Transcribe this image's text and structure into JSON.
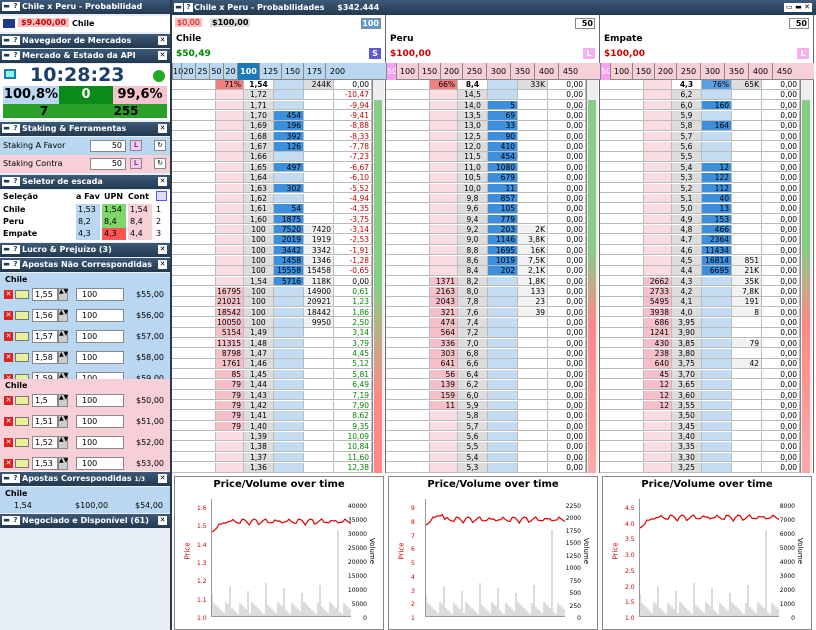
{
  "left": {
    "title": "Chile x Peru - Probabilidad",
    "balance": "$9.400,00",
    "balance_sel": "Chile",
    "nav_title": "Navegador de Mercados",
    "api_title": "Mercado & Estado da API",
    "clock": "10:28:23",
    "back_pct": "100,8%",
    "mid": "0",
    "lay_pct": "99,6%",
    "count1": "7",
    "count2": "255",
    "staking_title": "Staking & Ferramentas",
    "stake_back_label": "Staking A Favor",
    "stake_back_val": "50",
    "stake_lay_label": "Staking Contra",
    "stake_lay_val": "50",
    "ladder_sel_title": "Seletor de escada",
    "sel_headers": [
      "Seleção",
      "a Fav",
      "UPN",
      "Cont"
    ],
    "sel_rows": [
      [
        "Chile",
        "1,53",
        "1,54",
        "1,54",
        "1"
      ],
      [
        "Peru",
        "8,2",
        "8,4",
        "8,4",
        "2"
      ],
      [
        "Empate",
        "4,3",
        "4,3",
        "4,4",
        "3"
      ]
    ],
    "pnl_title": "Lucro & Prejuízo (3)",
    "unmatched_title": "Apostas Não Correspondidas",
    "unmatched_group1": "Chile",
    "unmatched1": [
      [
        "1,55",
        "100",
        "$55,00"
      ],
      [
        "1,56",
        "100",
        "$56,00"
      ],
      [
        "1,57",
        "100",
        "$57,00"
      ],
      [
        "1,58",
        "100",
        "$58,00"
      ],
      [
        "1,59",
        "100",
        "$59,00"
      ]
    ],
    "unmatched_group2": "Chile",
    "unmatched2": [
      [
        "1,5",
        "100",
        "$50,00"
      ],
      [
        "1,51",
        "100",
        "$51,00"
      ],
      [
        "1,52",
        "100",
        "$52,00"
      ],
      [
        "1,53",
        "100",
        "$53,00"
      ]
    ],
    "matched_title": "Apostas Correspondidas",
    "matched_tag": "1/3",
    "matched_group": "Chile",
    "matched_row": [
      "1,54",
      "$100,00",
      "$54,00"
    ],
    "traded_title": "Negociado e Disponível (61)"
  },
  "window": {
    "title": "Chile x Peru - Probabilidades",
    "total": "$342.444"
  },
  "selections": [
    {
      "profit": "$0,00",
      "stake": "$100,00",
      "stake_input": "100",
      "name": "Chile",
      "pl": "$50,49",
      "tag": "S",
      "ticks": [
        "10",
        "20",
        "25",
        "50",
        "20",
        "100",
        "125",
        "150",
        "175",
        "200"
      ],
      "active_tick": "100",
      "chart_title": "Price/Volume over time",
      "price_axis": "Price",
      "vol_axis": "Volume",
      "yl": [
        "1.6",
        "1.5",
        "1.4",
        "1.3",
        "1.2",
        "1.1",
        "1.0"
      ],
      "yr": [
        "40000",
        "35000",
        "30000",
        "25000",
        "20000",
        "15000",
        "10000",
        "5000",
        "0"
      ]
    },
    {
      "profit": "",
      "stake": "",
      "stake_input": "50",
      "name": "Peru",
      "pl": "$100,00",
      "tag": "L",
      "ticks": [
        "50",
        "100",
        "150",
        "200",
        "250",
        "300",
        "350",
        "400",
        "450"
      ],
      "active_tick": "",
      "chart_title": "Price/Volume over time",
      "price_axis": "Price",
      "vol_axis": "Volume",
      "yl": [
        "9",
        "8",
        "7",
        "6",
        "5",
        "4",
        "3",
        "2",
        "1"
      ],
      "yr": [
        "2250",
        "2000",
        "1750",
        "1500",
        "1250",
        "1000",
        "750",
        "500",
        "250",
        "0"
      ]
    },
    {
      "profit": "",
      "stake": "",
      "stake_input": "50",
      "name": "Empate",
      "pl": "$100,00",
      "tag": "L",
      "ticks": [
        "50",
        "100",
        "150",
        "200",
        "250",
        "300",
        "350",
        "400",
        "450"
      ],
      "active_tick": "",
      "chart_title": "Price/Volume over time",
      "price_axis": "Price",
      "vol_axis": "Volume",
      "yl": [
        "4.5",
        "4.0",
        "3.5",
        "3.0",
        "2.5",
        "2.0",
        "1.5",
        "1.0"
      ],
      "yr": [
        "8000",
        "7000",
        "6000",
        "5000",
        "4000",
        "3000",
        "2000",
        "1000",
        "0"
      ]
    }
  ],
  "ladders": [
    {
      "head": [
        "",
        "71%",
        "1,54",
        "",
        "244K",
        "0,00"
      ],
      "rows": [
        [
          "",
          "",
          "1,72",
          "",
          "",
          "-10,47"
        ],
        [
          "",
          "",
          "1,71",
          "",
          "",
          "-9,94"
        ],
        [
          "",
          "",
          "1,70",
          "454",
          "",
          "-9,41"
        ],
        [
          "",
          "",
          "1,69",
          "196",
          "",
          "-8,88"
        ],
        [
          "",
          "",
          "1,68",
          "392",
          "",
          "-8,33"
        ],
        [
          "",
          "",
          "1,67",
          "126",
          "",
          "-7,78"
        ],
        [
          "",
          "",
          "1,66",
          "",
          "",
          "-7,23"
        ],
        [
          "",
          "",
          "1,65",
          "497",
          "",
          "-6,67"
        ],
        [
          "",
          "",
          "1,64",
          "",
          "",
          "-6,10"
        ],
        [
          "",
          "",
          "1,63",
          "302",
          "",
          "-5,52"
        ],
        [
          "",
          "",
          "1,62",
          "",
          "",
          "-4,94"
        ],
        [
          "",
          "",
          "1,61",
          "54",
          "",
          "-4,35"
        ],
        [
          "",
          "",
          "1,60",
          "1875",
          "",
          "-3,75"
        ],
        [
          "",
          "",
          "100",
          "7520",
          "7420",
          "-3,14"
        ],
        [
          "",
          "",
          "100",
          "2019",
          "1919",
          "-2,53"
        ],
        [
          "",
          "",
          "100",
          "3442",
          "3342",
          "-1,91"
        ],
        [
          "",
          "",
          "100",
          "1458",
          "1346",
          "-1,28"
        ],
        [
          "",
          "",
          "100",
          "15558",
          "15458",
          "-0,65"
        ],
        [
          "",
          "",
          "1,54",
          "5716",
          "118K",
          "0,00"
        ],
        [
          "",
          "16795",
          "100",
          "",
          "14900",
          "0,61"
        ],
        [
          "",
          "21021",
          "100",
          "",
          "20921",
          "1,23"
        ],
        [
          "",
          "18542",
          "100",
          "",
          "18442",
          "1,86"
        ],
        [
          "",
          "10050",
          "100",
          "",
          "9950",
          "2,50"
        ],
        [
          "",
          "5154",
          "1,49",
          "",
          "",
          "3,14"
        ],
        [
          "",
          "11315",
          "1,48",
          "",
          "",
          "3,79"
        ],
        [
          "",
          "8798",
          "1,47",
          "",
          "",
          "4,45"
        ],
        [
          "",
          "1761",
          "1,46",
          "",
          "",
          "5,12"
        ],
        [
          "",
          "85",
          "1,45",
          "",
          "",
          "5,81"
        ],
        [
          "",
          "79",
          "1,44",
          "",
          "",
          "6,49"
        ],
        [
          "",
          "79",
          "1,43",
          "",
          "",
          "7,19"
        ],
        [
          "",
          "79",
          "1,42",
          "",
          "",
          "7,90"
        ],
        [
          "",
          "79",
          "1,41",
          "",
          "",
          "8,62"
        ],
        [
          "",
          "79",
          "1,40",
          "",
          "",
          "9,35"
        ],
        [
          "",
          "",
          "1,39",
          "",
          "",
          "10,09"
        ],
        [
          "",
          "",
          "1,38",
          "",
          "",
          "10,84"
        ],
        [
          "",
          "",
          "1,37",
          "",
          "",
          "11,60"
        ],
        [
          "",
          "",
          "1,36",
          "",
          "",
          "12,38"
        ]
      ]
    },
    {
      "head": [
        "",
        "66%",
        "8,4",
        "",
        "33K",
        "0,00"
      ],
      "rows": [
        [
          "",
          "",
          "14,5",
          "",
          "",
          "0,00"
        ],
        [
          "",
          "",
          "14,0",
          "5",
          "",
          "0,00"
        ],
        [
          "",
          "",
          "13,5",
          "69",
          "",
          "0,00"
        ],
        [
          "",
          "",
          "13,0",
          "33",
          "",
          "0,00"
        ],
        [
          "",
          "",
          "12,5",
          "90",
          "",
          "0,00"
        ],
        [
          "",
          "",
          "12,0",
          "410",
          "",
          "0,00"
        ],
        [
          "",
          "",
          "11,5",
          "454",
          "",
          "0,00"
        ],
        [
          "",
          "",
          "11,0",
          "1080",
          "",
          "0,00"
        ],
        [
          "",
          "",
          "10,5",
          "679",
          "",
          "0,00"
        ],
        [
          "",
          "",
          "10,0",
          "11",
          "",
          "0,00"
        ],
        [
          "",
          "",
          "9,8",
          "857",
          "",
          "0,00"
        ],
        [
          "",
          "",
          "9,6",
          "105",
          "",
          "0,00"
        ],
        [
          "",
          "",
          "9,4",
          "779",
          "",
          "0,00"
        ],
        [
          "",
          "",
          "9,2",
          "203",
          "2K",
          "0,00"
        ],
        [
          "",
          "",
          "9,0",
          "1146",
          "3,8K",
          "0,00"
        ],
        [
          "",
          "",
          "8,8",
          "1695",
          "16K",
          "0,00"
        ],
        [
          "",
          "",
          "8,6",
          "1019",
          "7,5K",
          "0,00"
        ],
        [
          "",
          "",
          "8,4",
          "202",
          "2,1K",
          "0,00"
        ],
        [
          "",
          "1371",
          "8,2",
          "",
          "1,8K",
          "0,00"
        ],
        [
          "",
          "2163",
          "8,0",
          "",
          "133",
          "0,00"
        ],
        [
          "",
          "2043",
          "7,8",
          "",
          "23",
          "0,00"
        ],
        [
          "",
          "321",
          "7,6",
          "",
          "39",
          "0,00"
        ],
        [
          "",
          "474",
          "7,4",
          "",
          "",
          "0,00"
        ],
        [
          "",
          "564",
          "7,2",
          "",
          "",
          "0,00"
        ],
        [
          "",
          "336",
          "7,0",
          "",
          "",
          "0,00"
        ],
        [
          "",
          "303",
          "6,8",
          "",
          "",
          "0,00"
        ],
        [
          "",
          "641",
          "6,6",
          "",
          "",
          "0,00"
        ],
        [
          "",
          "56",
          "6,4",
          "",
          "",
          "0,00"
        ],
        [
          "",
          "139",
          "6,2",
          "",
          "",
          "0,00"
        ],
        [
          "",
          "159",
          "6,0",
          "",
          "",
          "0,00"
        ],
        [
          "",
          "11",
          "5,9",
          "",
          "",
          "0,00"
        ],
        [
          "",
          "",
          "5,8",
          "",
          "",
          "0,00"
        ],
        [
          "",
          "",
          "5,7",
          "",
          "",
          "0,00"
        ],
        [
          "",
          "",
          "5,6",
          "",
          "",
          "0,00"
        ],
        [
          "",
          "",
          "5,5",
          "",
          "",
          "0,00"
        ],
        [
          "",
          "",
          "5,4",
          "",
          "",
          "0,00"
        ],
        [
          "",
          "",
          "5,3",
          "",
          "",
          "0,00"
        ]
      ]
    },
    {
      "head": [
        "",
        "",
        "4,3",
        "76%",
        "65K",
        "0,00"
      ],
      "rows": [
        [
          "",
          "",
          "6,2",
          "",
          "",
          "0,00"
        ],
        [
          "",
          "",
          "6,0",
          "160",
          "",
          "0,00"
        ],
        [
          "",
          "",
          "5,9",
          "",
          "",
          "0,00"
        ],
        [
          "",
          "",
          "5,8",
          "164",
          "",
          "0,00"
        ],
        [
          "",
          "",
          "5,7",
          "",
          "",
          "0,00"
        ],
        [
          "",
          "",
          "5,6",
          "",
          "",
          "0,00"
        ],
        [
          "",
          "",
          "5,5",
          "",
          "",
          "0,00"
        ],
        [
          "",
          "",
          "5,4",
          "12",
          "",
          "0,00"
        ],
        [
          "",
          "",
          "5,3",
          "122",
          "",
          "0,00"
        ],
        [
          "",
          "",
          "5,2",
          "112",
          "",
          "0,00"
        ],
        [
          "",
          "",
          "5,1",
          "40",
          "",
          "0,00"
        ],
        [
          "",
          "",
          "5,0",
          "13",
          "",
          "0,00"
        ],
        [
          "",
          "",
          "4,9",
          "153",
          "",
          "0,00"
        ],
        [
          "",
          "",
          "4,8",
          "466",
          "",
          "0,00"
        ],
        [
          "",
          "",
          "4,7",
          "2364",
          "",
          "0,00"
        ],
        [
          "",
          "",
          "4,6",
          "11434",
          "",
          "0,00"
        ],
        [
          "",
          "",
          "4,5",
          "16814",
          "851",
          "0,00"
        ],
        [
          "",
          "",
          "4,4",
          "6695",
          "21K",
          "0,00"
        ],
        [
          "",
          "2662",
          "4,3",
          "",
          "35K",
          "0,00"
        ],
        [
          "",
          "2733",
          "4,2",
          "",
          "7,8K",
          "0,00"
        ],
        [
          "",
          "5495",
          "4,1",
          "",
          "191",
          "0,00"
        ],
        [
          "",
          "3938",
          "4,0",
          "",
          "8",
          "0,00"
        ],
        [
          "",
          "686",
          "3,95",
          "",
          "",
          "0,00"
        ],
        [
          "",
          "1241",
          "3,90",
          "",
          "",
          "0,00"
        ],
        [
          "",
          "430",
          "3,85",
          "",
          "79",
          "0,00"
        ],
        [
          "",
          "238",
          "3,80",
          "",
          "",
          "0,00"
        ],
        [
          "",
          "640",
          "3,75",
          "",
          "42",
          "0,00"
        ],
        [
          "",
          "45",
          "3,70",
          "",
          "",
          "0,00"
        ],
        [
          "",
          "12",
          "3,65",
          "",
          "",
          "0,00"
        ],
        [
          "",
          "12",
          "3,60",
          "",
          "",
          "0,00"
        ],
        [
          "",
          "12",
          "3,55",
          "",
          "",
          "0,00"
        ],
        [
          "",
          "",
          "3,50",
          "",
          "",
          "0,00"
        ],
        [
          "",
          "",
          "3,45",
          "",
          "",
          "0,00"
        ],
        [
          "",
          "",
          "3,40",
          "",
          "",
          "0,00"
        ],
        [
          "",
          "",
          "3,35",
          "",
          "",
          "0,00"
        ],
        [
          "",
          "",
          "3,30",
          "",
          "",
          "0,00"
        ],
        [
          "",
          "",
          "3,25",
          "",
          "",
          "0,00"
        ]
      ]
    }
  ]
}
